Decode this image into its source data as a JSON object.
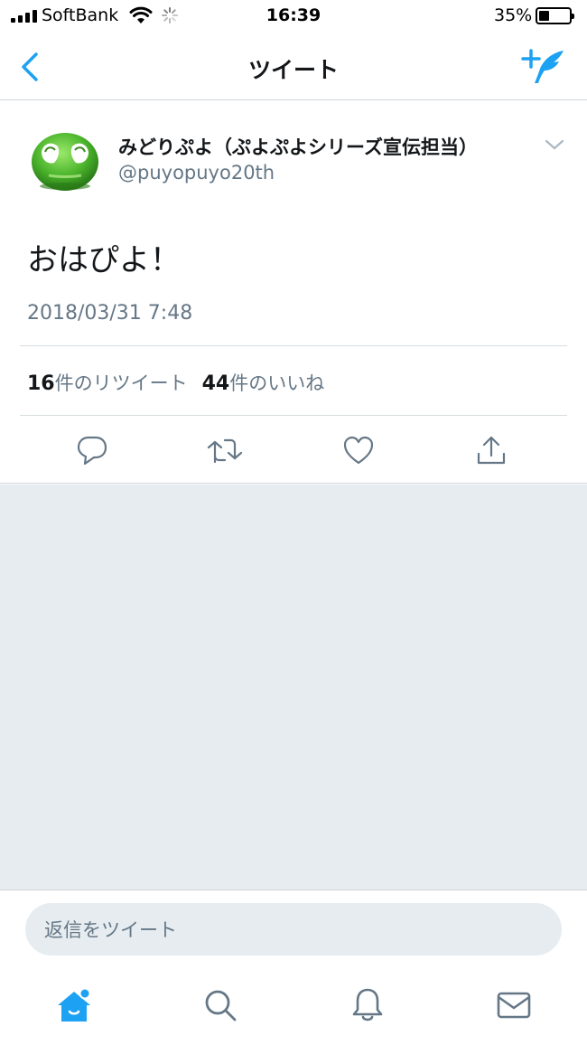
{
  "status_bar": {
    "carrier": "SoftBank",
    "time": "16:39",
    "battery_percent": "35%",
    "battery_level": 0.35
  },
  "nav": {
    "title": "ツイート",
    "back_icon": "chevron-left-icon",
    "compose_icon": "compose-tweet-icon"
  },
  "tweet": {
    "display_name": "みどりぷよ（ぷよぷよシリーズ宣伝担当）",
    "handle": "@puyopuyo20th",
    "text": "おはぴよ！",
    "timestamp": "2018/03/31 7:48",
    "retweet_count": "16",
    "retweet_label": "件のリツイート",
    "like_count": "44",
    "like_label": "件のいいね",
    "actions": [
      "reply-icon",
      "retweet-icon",
      "like-icon",
      "share-icon"
    ]
  },
  "reply": {
    "placeholder": "返信をツイート"
  },
  "tab_bar": {
    "items": [
      "home-icon",
      "search-icon",
      "notifications-icon",
      "messages-icon"
    ]
  },
  "colors": {
    "accent": "#1da1f2",
    "secondary_text": "#657786",
    "background_gray": "#e6ecf0",
    "avatar_green": "#4cb52c"
  }
}
